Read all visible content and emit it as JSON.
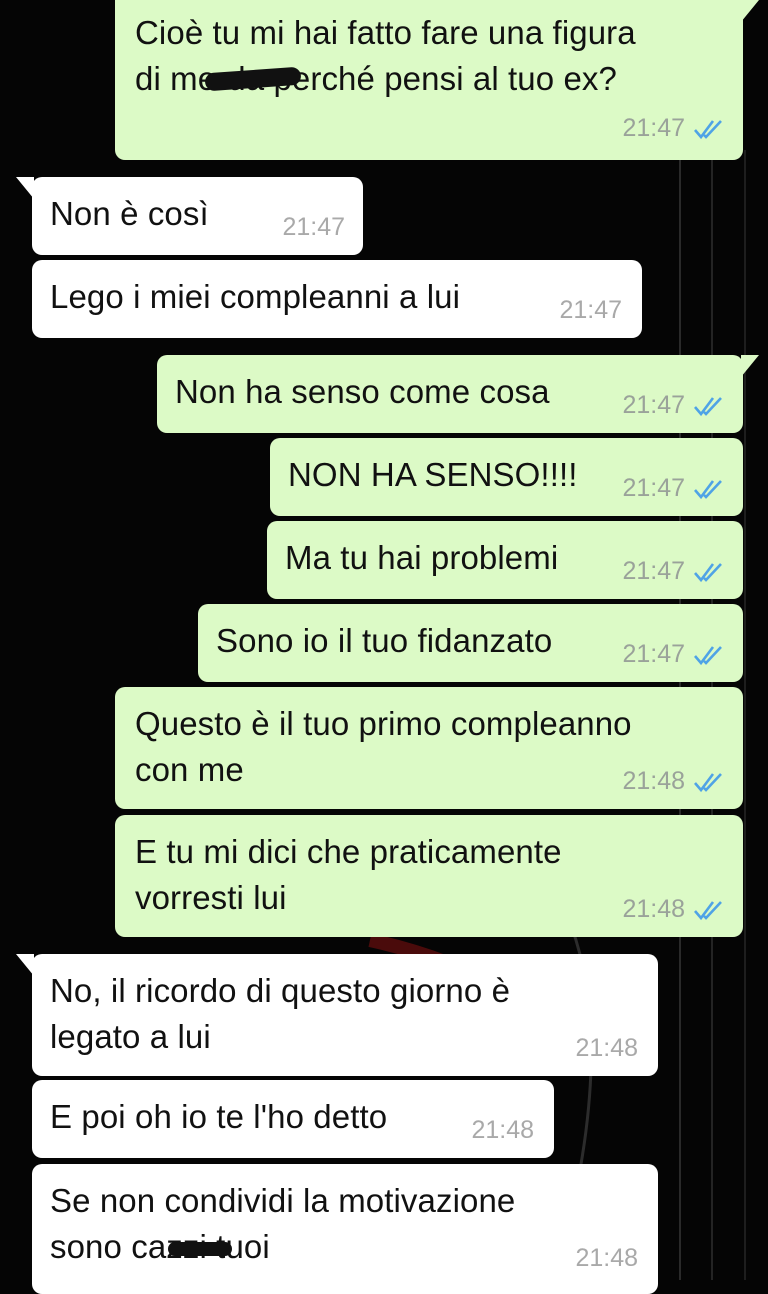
{
  "theme": {
    "outgoing_bubble": "#dcfac6",
    "incoming_bubble": "#ffffff",
    "read_ticks": "#4fa3e6",
    "background": "#050505"
  },
  "messages": [
    {
      "direction": "outgoing",
      "text": "Cioè tu mi hai fatto fare una figura\ndi merda perché pensi al tuo ex?",
      "time": "21:47",
      "status": "read-double-check-icon"
    },
    {
      "direction": "incoming",
      "text": "Non è così",
      "time": "21:47"
    },
    {
      "direction": "incoming",
      "text": "Lego i miei compleanni a lui",
      "time": "21:47"
    },
    {
      "direction": "outgoing",
      "text": "Non ha senso come cosa",
      "time": "21:47",
      "status": "read-double-check-icon"
    },
    {
      "direction": "outgoing",
      "text": "NON HA SENSO!!!!",
      "time": "21:47",
      "status": "read-double-check-icon"
    },
    {
      "direction": "outgoing",
      "text": "Ma tu hai problemi",
      "time": "21:47",
      "status": "read-double-check-icon"
    },
    {
      "direction": "outgoing",
      "text": "Sono io il tuo fidanzato",
      "time": "21:47",
      "status": "read-double-check-icon"
    },
    {
      "direction": "outgoing",
      "text": "Questo è il tuo primo compleanno\ncon me",
      "time": "21:48",
      "status": "read-double-check-icon"
    },
    {
      "direction": "outgoing",
      "text": "E tu mi dici che praticamente\nvorresti lui",
      "time": "21:48",
      "status": "read-double-check-icon"
    },
    {
      "direction": "incoming",
      "text": "No, il ricordo di questo giorno è\nlegato a lui",
      "time": "21:48"
    },
    {
      "direction": "incoming",
      "text": "E poi oh io te l'ho detto",
      "time": "21:48"
    },
    {
      "direction": "incoming",
      "text": "Se non condividi la motivazione\nsono cazzi tuoi",
      "time": "21:48"
    }
  ]
}
